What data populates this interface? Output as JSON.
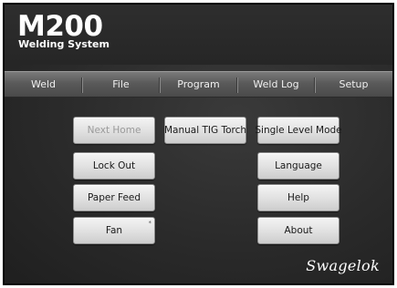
{
  "logo": {
    "title": "M200",
    "subtitle": "Welding System"
  },
  "menu": {
    "items": [
      {
        "label": "Weld"
      },
      {
        "label": "File"
      },
      {
        "label": "Program"
      },
      {
        "label": "Weld Log"
      },
      {
        "label": "Setup"
      }
    ]
  },
  "buttons": {
    "next_home": {
      "label": "Next Home",
      "state": "disabled"
    },
    "lock_out": {
      "label": "Lock Out"
    },
    "paper_feed": {
      "label": "Paper Feed"
    },
    "fan": {
      "label": "Fan",
      "corner_mark": "*"
    },
    "manual_tig_torch": {
      "label": "Manual TIG Torch"
    },
    "single_level_mode": {
      "label": "Single Level Mode"
    },
    "language": {
      "label": "Language"
    },
    "help": {
      "label": "Help"
    },
    "about": {
      "label": "About"
    }
  },
  "brand": {
    "name": "Swagelok"
  }
}
